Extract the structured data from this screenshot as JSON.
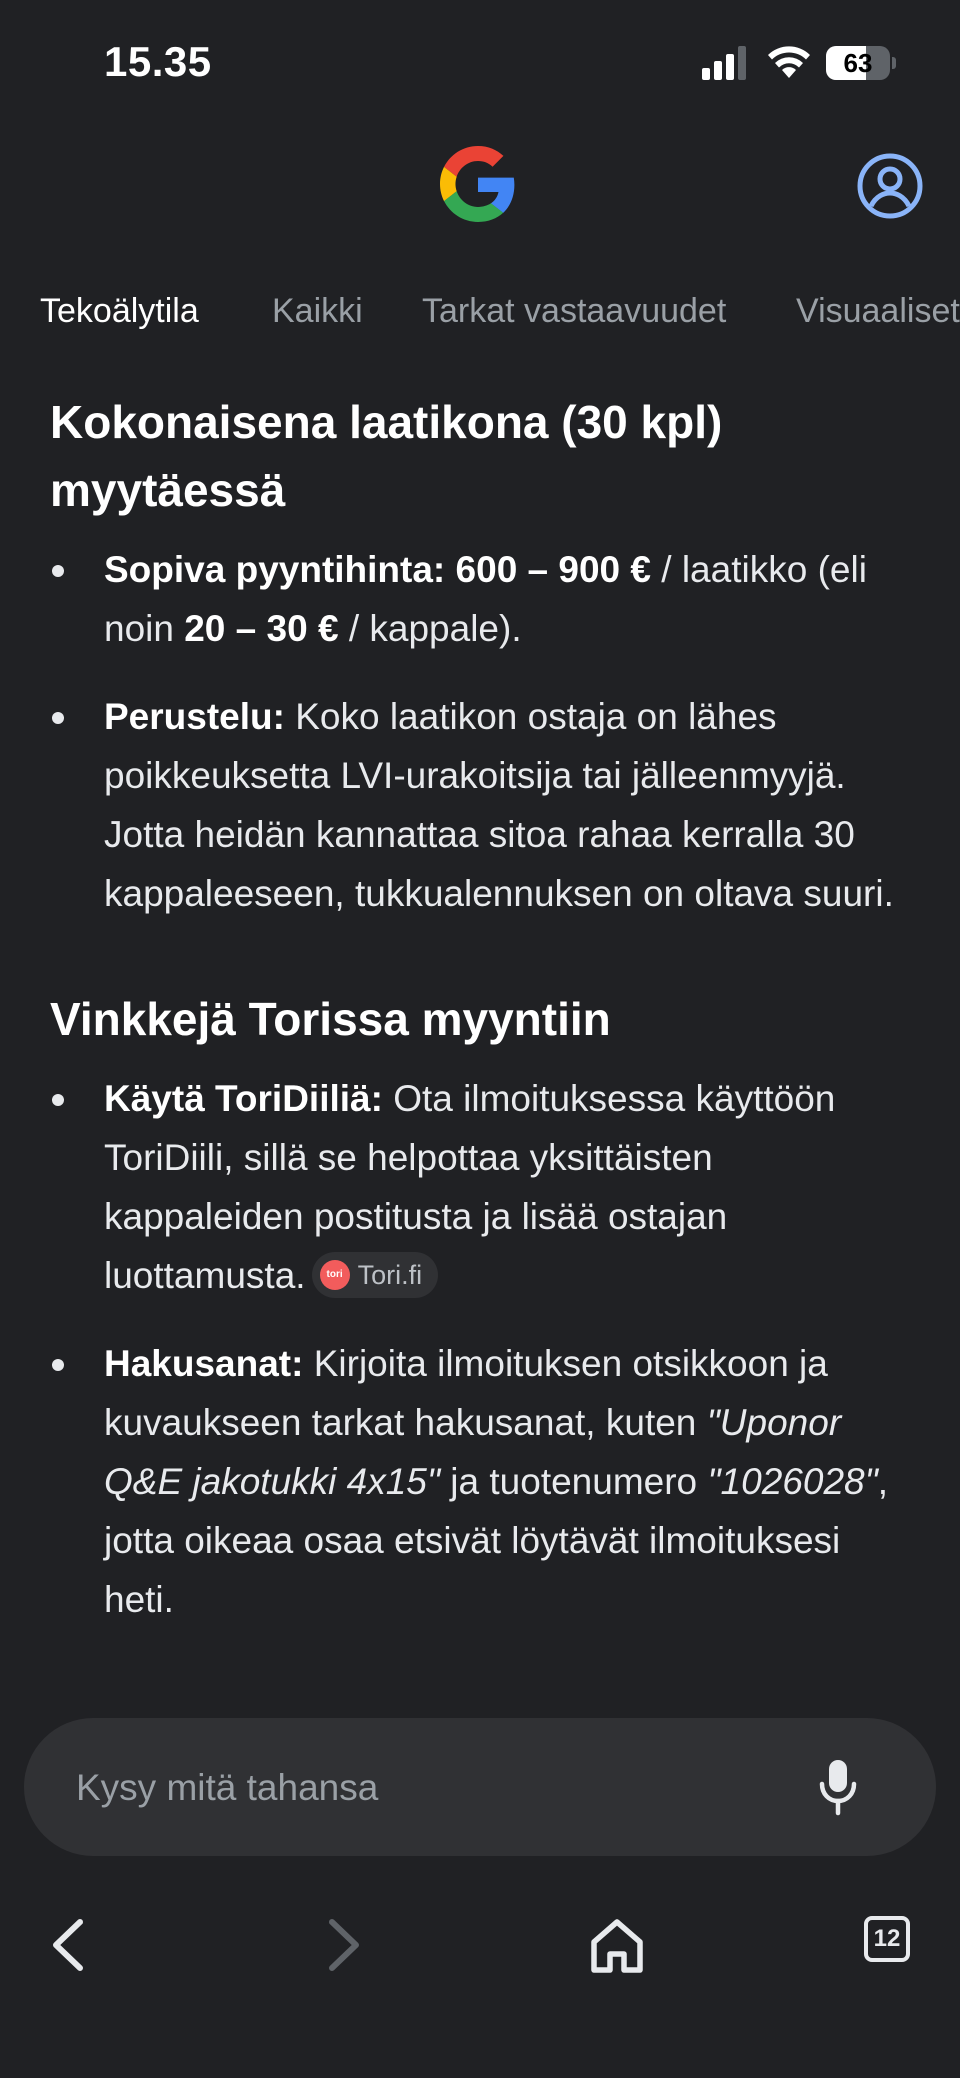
{
  "status_bar": {
    "time": "15.35",
    "battery_percent": "63",
    "battery_level": 0.63
  },
  "tabs": [
    {
      "label": "Tekoälytila",
      "active": true
    },
    {
      "label": "Kaikki",
      "active": false
    },
    {
      "label": "Tarkat vastaavuudet",
      "active": false
    },
    {
      "label": "Visuaaliset",
      "active": false
    }
  ],
  "content": {
    "heading1": "Kokonaisena laatikona (30 kpl) myytäessä",
    "bullet1": {
      "b1": "Sopiva pyyntihinta: 600 – 900 €",
      "t1": " / laatikko (eli noin ",
      "b2": "20 – 30 €",
      "t2": " / kappale)."
    },
    "bullet2": {
      "b1": "Perustelu:",
      "t1": " Koko laatikon ostaja on lähes poikkeuksetta LVI-urakoitsija tai jälleenmyyjä. Jotta heidän kannattaa sitoa rahaa kerralla 30 kappaleeseen, tukkualennuksen on oltava suuri."
    },
    "heading2": "Vinkkejä Torissa myyntiin",
    "bullet3": {
      "b1": "Käytä ToriDiiliä:",
      "t1": " Ota ilmoituksessa käyttöön ToriDiili, sillä se helpottaa yksittäisten kappaleiden postitusta ja lisää ostajan luottamusta.",
      "chip_logo": "tori",
      "chip_label": "Tori.fi"
    },
    "bullet4": {
      "b1": "Hakusanat:",
      "t1": " Kirjoita ilmoituksen otsikkoon ja kuvaukseen tarkat hakusanat, kuten ",
      "i1": "\"Uponor Q&E jakotukki 4x15\"",
      "t2": " ja tuotenumero ",
      "i2": "\"1026028\"",
      "t3": ", jotta oikeaa osaa etsivät löytävät ilmoituksesi heti."
    }
  },
  "ask_bar": {
    "placeholder": "Kysy mitä tahansa"
  },
  "bottom_nav": {
    "tab_count": "12"
  },
  "colors": {
    "background": "#202124",
    "surface": "#303134",
    "account_icon": "#8ab4f8",
    "tori_brand": "#f25c5c"
  },
  "icons": [
    "signal-icon",
    "wifi-icon",
    "google-g-logo",
    "account-icon",
    "mic-icon",
    "back-icon",
    "forward-icon",
    "home-icon",
    "tabs-icon"
  ]
}
